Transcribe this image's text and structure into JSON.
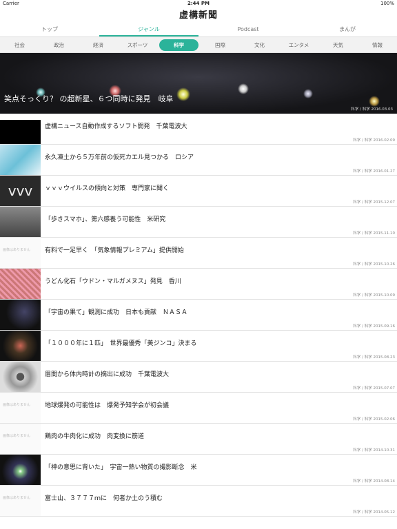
{
  "status": {
    "carrier": "Carrier",
    "time": "2:44 PM",
    "battery": "100%"
  },
  "app_title": "虚構新聞",
  "main_tabs": [
    "トップ",
    "ジャンル",
    "Podcast",
    "まんが"
  ],
  "genres": [
    "社会",
    "政治",
    "経済",
    "スポーツ",
    "科学",
    "国際",
    "文化",
    "エンタメ",
    "天気",
    "情報"
  ],
  "hero": {
    "title": "笑点そっくり？ の超新星、６つ同時に発見　岐阜",
    "meta": "科学 / 科学 2016.03.03"
  },
  "no_image_text": "画像はありません",
  "articles": [
    {
      "title": "虚構ニュース自動作成するソフト開発　千葉電波大",
      "meta": "科学 / 科学 2016.02.09"
    },
    {
      "title": "永久凍土から５万年前の仮死カエル見つかる　ロシア",
      "meta": "科学 / 科学 2016.01.27"
    },
    {
      "title": "ｖｖｖウイルスの傾向と対策　専門家に聞く",
      "meta": "科学 / 科学 2015.12.07"
    },
    {
      "title": "「歩きスマホ」、第六感養う可能性　米研究",
      "meta": "科学 / 科学 2015.11.10"
    },
    {
      "title": "有料で一足早く　「気象情報プレミアム」提供開始",
      "meta": "科学 / 科学 2015.10.26"
    },
    {
      "title": "うどん化石「ウドン・マルガメヌス」発見　香川",
      "meta": "科学 / 科学 2015.10.09"
    },
    {
      "title": "「宇宙の果て」観測に成功　日本も貢献　ＮＡＳＡ",
      "meta": "科学 / 科学 2015.09.16"
    },
    {
      "title": "「１０００年に１匹」　世界最優秀「美ジンコ」決まる",
      "meta": "科学 / 科学 2015.08.23"
    },
    {
      "title": "眉間から体内時計の摘出に成功　千葉電波大",
      "meta": "科学 / 科学 2015.07.07"
    },
    {
      "title": "地球爆発の可能性は　爆発予知学会が初会議",
      "meta": "科学 / 科学 2015.02.06"
    },
    {
      "title": "鶏肉の牛肉化に成功　肉変換に筋道",
      "meta": "科学 / 科学 2014.10.31"
    },
    {
      "title": "「神の意思に背いた」　宇宙一熱い物質の撮影断念　米",
      "meta": "科学 / 科学 2014.08.14"
    },
    {
      "title": "富士山、３７７７ｍに　何者か土のう積む",
      "meta": "科学 / 科学 2014.05.12"
    }
  ]
}
